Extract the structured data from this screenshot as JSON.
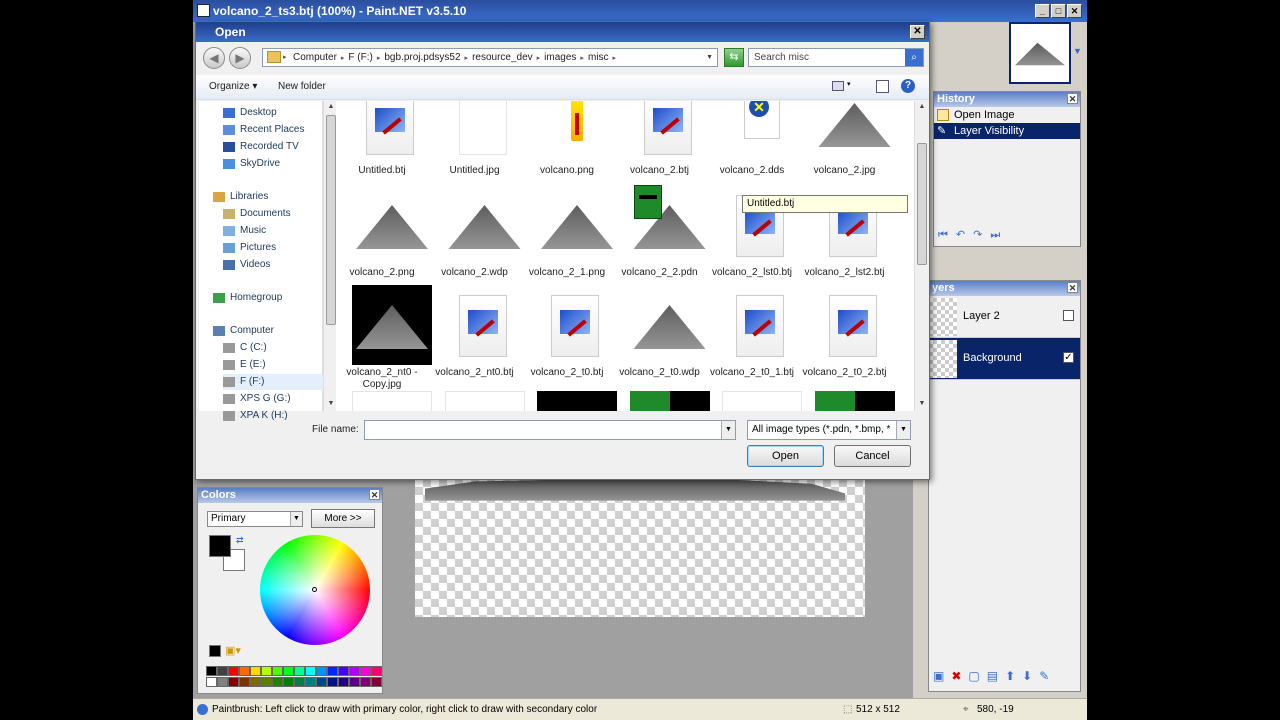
{
  "app": {
    "title": "volcano_2_ts3.btj (100%) - Paint.NET v3.5.10",
    "controls": {
      "minimize": "_",
      "maximize": "□",
      "close": "✕"
    }
  },
  "history_panel": {
    "title": "History",
    "items": [
      {
        "label": "Open Image",
        "selected": false
      },
      {
        "label": "Layer Visibility",
        "selected": true
      }
    ]
  },
  "layers_panel": {
    "title": "yers",
    "layers": [
      {
        "name": "Layer 2",
        "visible": false,
        "selected": false
      },
      {
        "name": "Background",
        "visible": true,
        "selected": true
      }
    ]
  },
  "colors_panel": {
    "title": "Colors",
    "mode_select": "Primary",
    "more_button": "More >>",
    "primary_color": "#000000",
    "secondary_color": "#ffffff",
    "palette_row1": [
      "#000000",
      "#404040",
      "#ff0000",
      "#ff6a00",
      "#ffd800",
      "#b6ff00",
      "#4cff00",
      "#00ff21",
      "#00ff90",
      "#00ffff",
      "#0094ff",
      "#0026ff",
      "#4800ff",
      "#b200ff",
      "#ff00dc",
      "#ff006e"
    ],
    "palette_row2": [
      "#ffffff",
      "#808080",
      "#7f0000",
      "#7f3300",
      "#7f6a00",
      "#5b7f00",
      "#267f00",
      "#007f0e",
      "#007f46",
      "#007f7f",
      "#004a7f",
      "#00137f",
      "#21007f",
      "#57007f",
      "#7f006e",
      "#7f0037"
    ]
  },
  "dialog": {
    "title": "Open",
    "breadcrumb": [
      "Computer",
      "F (F:)",
      "bgb.proj.pdsys52",
      "resource_dev",
      "images",
      "misc"
    ],
    "search_placeholder": "Search misc",
    "toolbar": {
      "organize": "Organize",
      "new_folder": "New folder"
    },
    "nav": [
      {
        "label": "Desktop",
        "icon": "desktop-icon"
      },
      {
        "label": "Recent Places",
        "icon": "recent-places-icon"
      },
      {
        "label": "Recorded TV",
        "icon": "tv-icon"
      },
      {
        "label": "SkyDrive",
        "icon": "cloud-icon"
      },
      {
        "label": "Libraries",
        "icon": "library-icon"
      },
      {
        "label": "Documents",
        "icon": "documents-icon"
      },
      {
        "label": "Music",
        "icon": "music-icon"
      },
      {
        "label": "Pictures",
        "icon": "pictures-icon"
      },
      {
        "label": "Videos",
        "icon": "videos-icon"
      },
      {
        "label": "Homegroup",
        "icon": "homegroup-icon"
      },
      {
        "label": "Computer",
        "icon": "computer-icon"
      },
      {
        "label": "C (C:)",
        "icon": "drive-icon"
      },
      {
        "label": "E (E:)",
        "icon": "drive-icon"
      },
      {
        "label": "F (F:)",
        "icon": "drive-icon"
      },
      {
        "label": "XPS G (G:)",
        "icon": "drive-icon"
      },
      {
        "label": "XPA K (H:)",
        "icon": "drive-icon"
      }
    ],
    "files_row1": [
      {
        "name": "Untitled.btj",
        "kind": "doc"
      },
      {
        "name": "Untitled.jpg",
        "kind": "blank"
      },
      {
        "name": "volcano.png",
        "kind": "flame"
      },
      {
        "name": "volcano_2.btj",
        "kind": "doc"
      },
      {
        "name": "volcano_2.dds",
        "kind": "dds"
      },
      {
        "name": "volcano_2.jpg",
        "kind": "mountain"
      }
    ],
    "files_row2": [
      {
        "name": "volcano_2.png",
        "kind": "mountain"
      },
      {
        "name": "volcano_2.wdp",
        "kind": "mountain"
      },
      {
        "name": "volcano_2_1.png",
        "kind": "mountain"
      },
      {
        "name": "volcano_2_2.pdn",
        "kind": "mountain-face"
      },
      {
        "name": "volcano_2_lst0.btj",
        "kind": "doc"
      },
      {
        "name": "volcano_2_lst2.btj",
        "kind": "doc"
      }
    ],
    "files_row3": [
      {
        "name": "volcano_2_nt0 - Copy.jpg",
        "kind": "mountain-dark"
      },
      {
        "name": "volcano_2_nt0.btj",
        "kind": "doc"
      },
      {
        "name": "volcano_2_t0.btj",
        "kind": "doc"
      },
      {
        "name": "volcano_2_t0.wdp",
        "kind": "mountain"
      },
      {
        "name": "volcano_2_t0_1.btj",
        "kind": "doc"
      },
      {
        "name": "volcano_2_t0_2.btj",
        "kind": "doc"
      }
    ],
    "tooltip": "Untitled.btj",
    "file_name_label": "File name:",
    "file_name_value": "",
    "file_type": "All image types (*.pdn, *.bmp, *",
    "open_button": "Open",
    "cancel_button": "Cancel"
  },
  "status": {
    "hint": "Paintbrush: Left click to draw with primary color, right click to draw with secondary color",
    "image_size": "512 x 512",
    "cursor_pos": "580, -19"
  }
}
